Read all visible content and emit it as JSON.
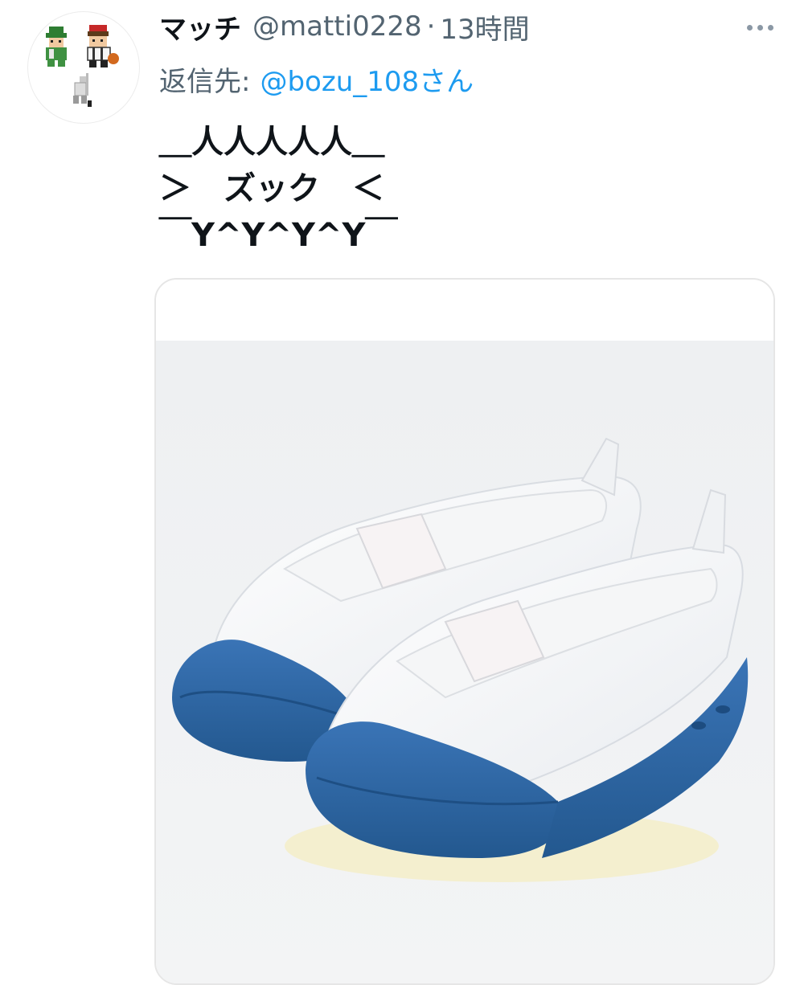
{
  "tweet": {
    "display_name": "マッチ",
    "handle": "@matti0228",
    "separator": "·",
    "time": "13時間",
    "reply_prefix": "返信先:",
    "reply_mention": "@bozu_108さん",
    "text_lines": [
      "＿人人人人人＿",
      "＞　ズック　＜",
      "￣Y^Y^Y^Y￣"
    ]
  },
  "icons": {
    "more": "more-horizontal-icon"
  },
  "colors": {
    "link": "#1d9bf0",
    "secondary_text": "#536471",
    "shoe_toe_blue": "#2f66a6"
  }
}
